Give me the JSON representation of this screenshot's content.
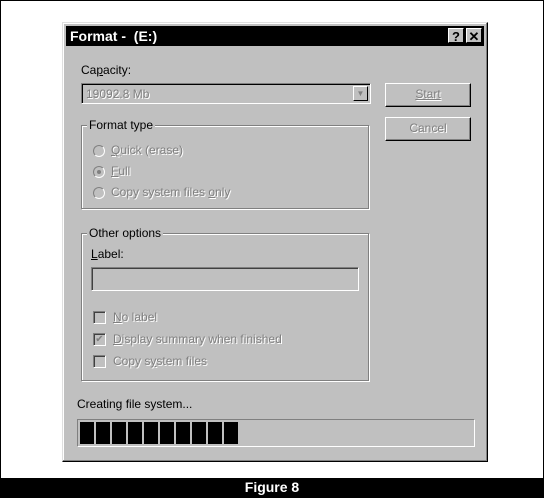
{
  "window": {
    "title": "Format -  (E:)",
    "help_label": "?",
    "close_label": "✕"
  },
  "capacity": {
    "label_prefix": "Ca",
    "label_underline": "p",
    "label_suffix": "acity:",
    "value": "19092.8 Mb"
  },
  "buttons": {
    "start": "Start",
    "cancel": "Cancel"
  },
  "format_type": {
    "title": "Format type",
    "options": [
      {
        "u": "Q",
        "rest": "uick (erase)",
        "checked": false
      },
      {
        "u": "F",
        "rest": "ull",
        "checked": true
      },
      {
        "pre": "Copy system files ",
        "u": "o",
        "rest": "nly",
        "checked": false
      }
    ]
  },
  "other_options": {
    "title": "Other options",
    "label_underline": "L",
    "label_rest": "abel:",
    "label_value": "",
    "checks": [
      {
        "u": "N",
        "rest": "o label",
        "checked": false
      },
      {
        "u": "D",
        "rest": "isplay summary when finished",
        "checked": true
      },
      {
        "pre": "Copy s",
        "u": "y",
        "rest": "stem files",
        "checked": false
      }
    ]
  },
  "status": {
    "text": "Creating file system...",
    "progress_fraction": 0.47,
    "blocks": 10
  },
  "figure_caption": "Figure 8",
  "icons": {
    "combo_arrow": "chevron-down-icon",
    "check_mark": "checkmark-icon"
  }
}
